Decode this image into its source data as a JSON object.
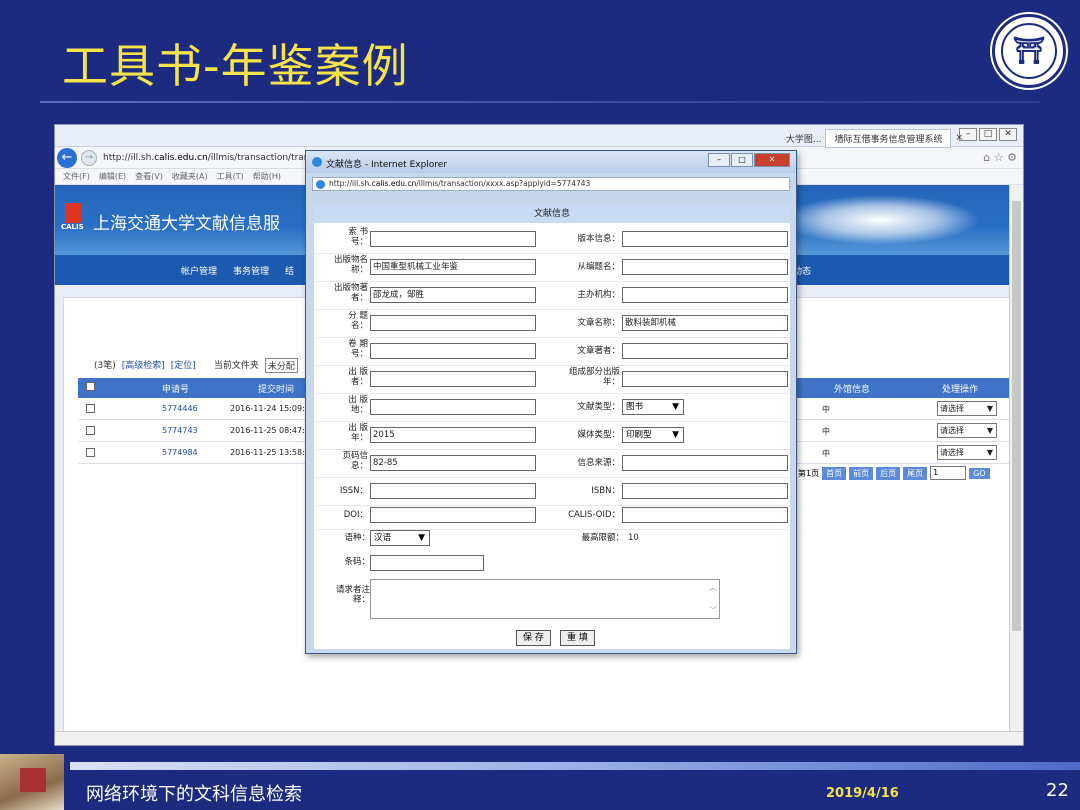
{
  "slide": {
    "title": "工具书-年鉴案例",
    "footer_text": "网络环境下的文科信息检索",
    "date": "2019/4/16",
    "page_number": "22"
  },
  "browser": {
    "url_prefix": "http://ill.sh.",
    "url_domain": "calis.edu.cn",
    "url_rest": "/illmis/transaction/trans",
    "tab_right": "墙际互借事务信息管理系统",
    "tab_left_partial": "大学图...",
    "menu": [
      "文件(F)",
      "编辑(E)",
      "查看(V)",
      "收藏夹(A)",
      "工具(T)",
      "帮助(H)"
    ]
  },
  "site": {
    "banner_title": "上海交通大学文献信息服",
    "calis_label": "CALIS",
    "nav": [
      "帐户管理",
      "事务管理",
      "结"
    ],
    "nav_right": "动态",
    "toolbar": {
      "count": "(3笔)",
      "advanced": "[高级检索]",
      "locate": "[定位]",
      "folder_label": "当前文件夹",
      "folder_value": "未分配"
    },
    "table": {
      "headers": [
        "申请号",
        "提交时间",
        "外馆信息",
        "处理操作"
      ],
      "rows": [
        {
          "id": "5774446",
          "time": "2016-11-24 15:09:1",
          "mark": "中",
          "action": "请选择"
        },
        {
          "id": "5774743",
          "time": "2016-11-25 08:47:1",
          "mark": "中",
          "action": "请选择"
        },
        {
          "id": "5774984",
          "time": "2016-11-25 13:58:5",
          "mark": "中",
          "action": "请选择"
        }
      ]
    },
    "pager": {
      "label": "第1页",
      "buttons": [
        "首页",
        "前页",
        "后页",
        "尾页"
      ],
      "page_value": "1",
      "go": "GO"
    }
  },
  "popup": {
    "window_title": "文献信息 - Internet Explorer",
    "url_prefix": "http://ill.sh.",
    "url_domain": "calis.edu.cn",
    "url_rest": "/illmis/transaction/xxxx.asp?applyid=5774743",
    "form_title": "文献信息",
    "fields_left": [
      {
        "label": "索 书\n号：",
        "value": ""
      },
      {
        "label": "出版物名\n称：",
        "value": "中国重型机械工业年鉴"
      },
      {
        "label": "出版物著\n者：",
        "value": "邵龙成，邹胜"
      },
      {
        "label": "分 题\n名：",
        "value": ""
      },
      {
        "label": "卷 期\n号：",
        "value": ""
      },
      {
        "label": "出 版\n者：",
        "value": ""
      },
      {
        "label": "出 版\n地：",
        "value": ""
      },
      {
        "label": "出 版\n年：",
        "value": "2015"
      },
      {
        "label": "页码信\n息：",
        "value": "82-85"
      },
      {
        "label": "ISSN：",
        "value": ""
      },
      {
        "label": "DOI：",
        "value": ""
      }
    ],
    "fields_right": [
      {
        "label": "版本信息：",
        "value": ""
      },
      {
        "label": "从编题名：",
        "value": ""
      },
      {
        "label": "主办机构：",
        "value": ""
      },
      {
        "label": "文章名称：",
        "value": "散料装卸机械"
      },
      {
        "label": "文章著者：",
        "value": ""
      },
      {
        "label": "组成部分出版\n年：",
        "value": ""
      },
      {
        "label": "文献类型：",
        "value": "图书"
      },
      {
        "label": "媒体类型：",
        "value": "印刷型"
      },
      {
        "label": "信息来源：",
        "value": ""
      },
      {
        "label": "ISBN：",
        "value": ""
      },
      {
        "label": "CALIS-OID：",
        "value": ""
      }
    ],
    "language_label": "语种：",
    "language_value": "汉语",
    "limit_label": "最高限额：",
    "limit_value": "10",
    "barcode_label": "条码：",
    "note_label": "请求者注\n释：",
    "save_label": "保 存",
    "reset_label": "重 填"
  },
  "colors": {
    "slide_bg": "#1c2b80",
    "title_yellow": "#f6e34a",
    "table_header": "#3e73c8"
  }
}
